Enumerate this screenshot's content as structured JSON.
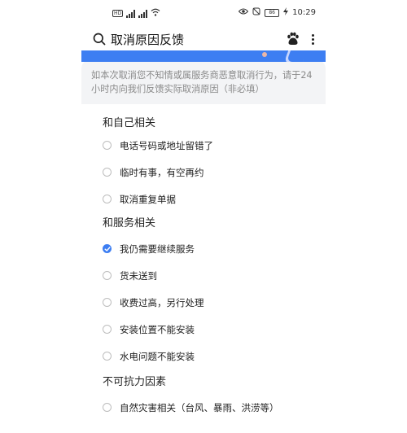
{
  "status_bar": {
    "sim1": "HD",
    "sim2": "HD",
    "battery": "86",
    "time": "10:29"
  },
  "header": {
    "title": "取消原因反馈"
  },
  "note": {
    "placeholder": "如本次取消您不知情或属服务商恶意取消行为，请于24小时内向我们反馈实际取消原因（非必填）"
  },
  "sections": [
    {
      "title": "和自己相关",
      "options": [
        {
          "label": "电话号码或地址留错了",
          "checked": false
        },
        {
          "label": "临时有事，有空再约",
          "checked": false
        },
        {
          "label": "取消重复单据",
          "checked": false
        }
      ]
    },
    {
      "title": "和服务相关",
      "options": [
        {
          "label": "我仍需要继续服务",
          "checked": true
        },
        {
          "label": "货未送到",
          "checked": false
        },
        {
          "label": "收费过高，另行处理",
          "checked": false
        },
        {
          "label": "安装位置不能安装",
          "checked": false
        },
        {
          "label": "水电问题不能安装",
          "checked": false
        }
      ]
    },
    {
      "title": "不可抗力因素",
      "options": [
        {
          "label": "自然灾害相关（台风、暴雨、洪涝等）",
          "checked": false
        }
      ]
    }
  ],
  "colors": {
    "accent": "#3d7ef2"
  }
}
